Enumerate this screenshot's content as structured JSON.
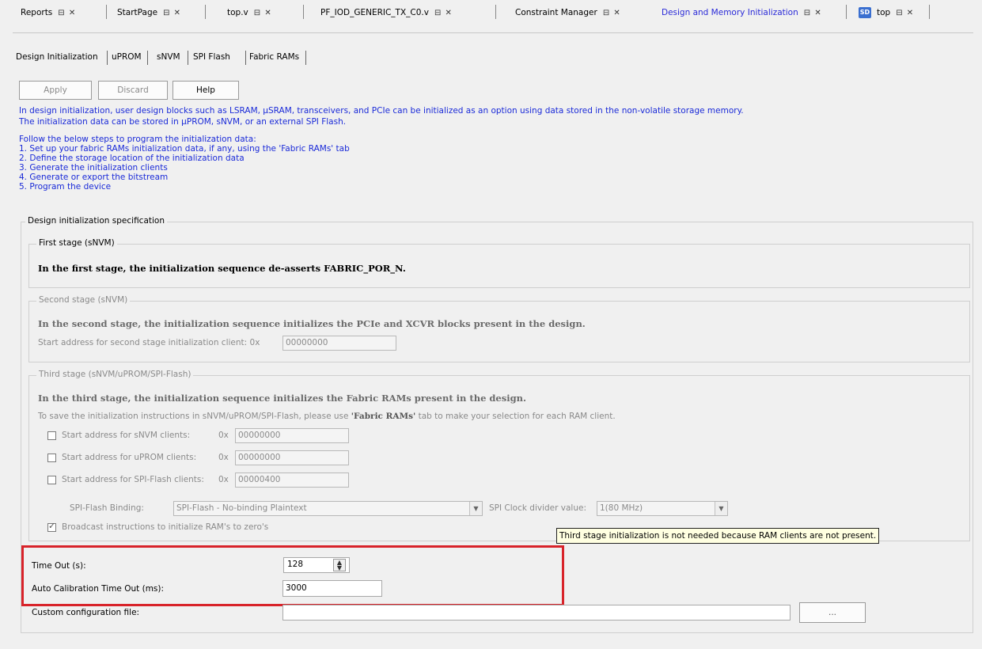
{
  "doc_tabs": [
    {
      "label": "Reports",
      "controls": "⊟ ✕"
    },
    {
      "label": "StartPage",
      "controls": "⊟ ✕"
    },
    {
      "label": "top.v",
      "controls": "⊟ ✕"
    },
    {
      "label": "PF_IOD_GENERIC_TX_C0.v",
      "controls": "⊟ ✕"
    },
    {
      "label": "Constraint Manager",
      "controls": "⊟ ✕"
    },
    {
      "label": "Design and Memory Initialization",
      "controls": "⊟ ✕"
    },
    {
      "label": "top",
      "icon": "SD",
      "controls": "⊟ ✕"
    }
  ],
  "sub_tabs": [
    "Design Initialization",
    "uPROM",
    "sNVM",
    "SPI Flash",
    "Fabric RAMs"
  ],
  "buttons": {
    "apply": "Apply",
    "discard": "Discard",
    "help": "Help"
  },
  "info": {
    "line1": "In design initialization, user design blocks such as LSRAM, µSRAM, transceivers, and PCIe can be initialized as an option using data stored in the non-volatile storage memory.",
    "line2": "The initialization data can be stored in µPROM, sNVM, or an external SPI Flash.",
    "steps_intro": "Follow the below steps to program the initialization data:",
    "steps": [
      "1. Set up your fabric RAMs initialization data, if any, using the 'Fabric RAMs' tab",
      "2. Define the storage location of the initialization data",
      "3. Generate the initialization clients",
      "4. Generate or export the bitstream",
      "5. Program the device"
    ]
  },
  "spec": {
    "title": "Design initialization specification",
    "first_stage": {
      "legend": "First stage (sNVM)",
      "text": "In the first stage, the initialization sequence de-asserts FABRIC_POR_N."
    },
    "second_stage": {
      "legend": "Second stage (sNVM)",
      "text": "In the second stage, the initialization sequence initializes the PCIe and XCVR blocks present in the design.",
      "addr_label": "Start address for second stage initialization client:  0x",
      "addr_value": "00000000"
    },
    "third_stage": {
      "legend": "Third stage (sNVM/uPROM/SPI-Flash)",
      "text": "In the third stage, the initialization sequence initializes the Fabric RAMs present in the design.",
      "note_pre": "To save the initialization instructions in sNVM/uPROM/SPI-Flash, please use ",
      "note_bold": "'Fabric RAMs'",
      "note_post": " tab to make your selection for each RAM client.",
      "snvm_label": "Start address for sNVM clients:",
      "snvm_value": "00000000",
      "uprom_label": "Start address for uPROM clients:",
      "uprom_value": "00000000",
      "spi_label": "Start address for SPI-Flash clients:",
      "spi_value": "00000400",
      "hex_prefix": "0x",
      "binding_label": "SPI-Flash Binding:",
      "binding_value": "SPI-Flash - No-binding Plaintext",
      "clock_label": "SPI Clock divider value:",
      "clock_value": "1(80 MHz)",
      "broadcast_label": "Broadcast instructions to initialize RAM's to zero's",
      "broadcast_checked": true
    },
    "tooltip": "Third stage initialization is not needed because RAM clients are not present."
  },
  "timeout": {
    "label": "Time Out (s):",
    "value": "128"
  },
  "auto_cal": {
    "label": "Auto Calibration Time Out (ms):",
    "value": "3000"
  },
  "custom_config": {
    "label": "Custom configuration file:",
    "value": "",
    "browse_label": "..."
  },
  "colors": {
    "info_text": "#1a2ad8",
    "highlight": "#d8232a",
    "active_tab": "#2a2ad8"
  }
}
